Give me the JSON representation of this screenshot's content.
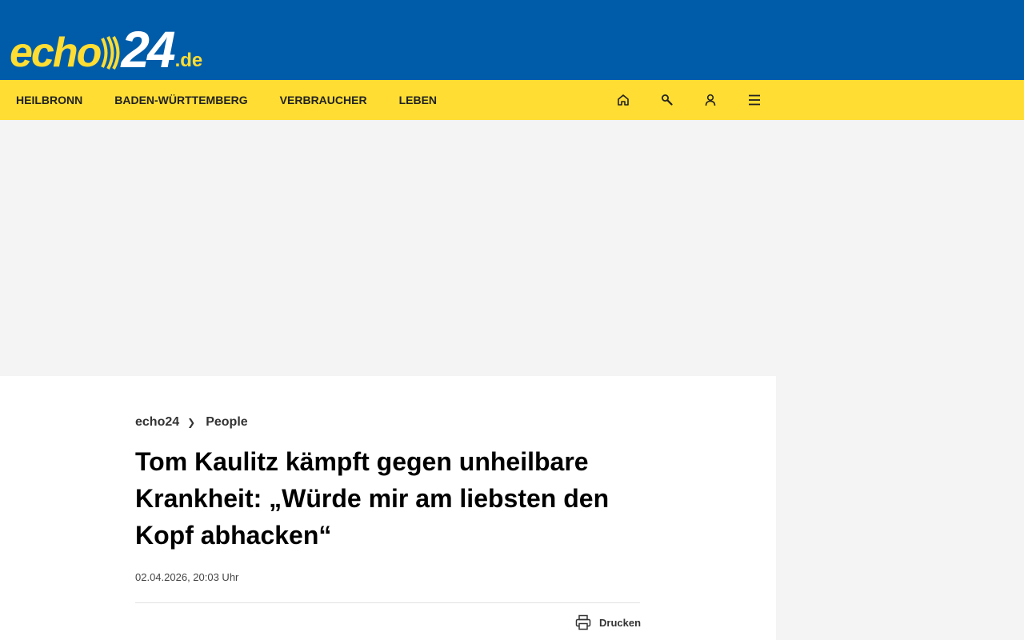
{
  "header": {
    "logo": {
      "text_echo": "echo",
      "text_24": "24",
      "text_de": ".de"
    }
  },
  "nav": {
    "items": [
      "HEILBRONN",
      "BADEN-WÜRTTEMBERG",
      "VERBRAUCHER",
      "LEBEN"
    ],
    "icons": [
      "home-icon",
      "search-icon",
      "user-icon",
      "menu-icon"
    ]
  },
  "colors": {
    "header_blue": "#005ca9",
    "nav_yellow": "#ffdd33",
    "ad_background": "#f4f4f4"
  },
  "article": {
    "breadcrumb": {
      "home": "echo24",
      "separator": "❯",
      "section": "People"
    },
    "headline": "Tom Kaulitz kämpft gegen unheilbare Krankheit: „Würde mir am liebsten den Kopf abhacken“",
    "date": "02.04.2026, 20:03 Uhr",
    "print_label": "Drucken"
  }
}
